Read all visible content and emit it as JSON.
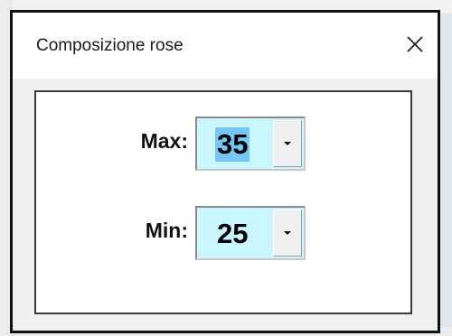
{
  "dialog": {
    "title": "Composizione rose",
    "close_icon": "close-icon"
  },
  "fields": {
    "max": {
      "label": "Max:",
      "value": "35",
      "dropdown_icon": "dropdown-arrow-icon"
    },
    "min": {
      "label": "Min:",
      "value": "25",
      "dropdown_icon": "dropdown-arrow-icon"
    }
  },
  "colors": {
    "combo_background": "#c9f6ff",
    "selection_highlight": "#76c7f5"
  }
}
